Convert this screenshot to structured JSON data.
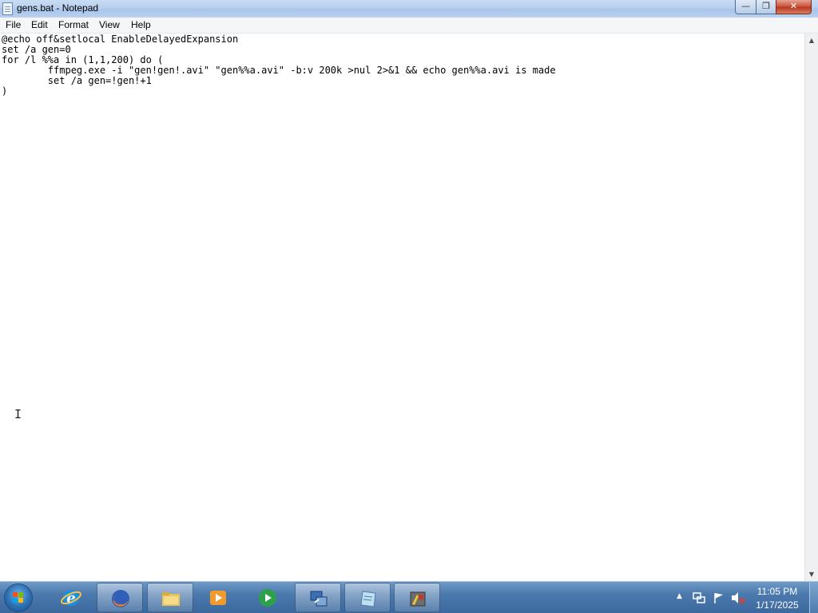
{
  "window": {
    "title": "gens.bat - Notepad",
    "minimize_glyph": "—",
    "maximize_glyph": "❐",
    "close_glyph": "✕"
  },
  "menu": {
    "file": "File",
    "edit": "Edit",
    "format": "Format",
    "view": "View",
    "help": "Help"
  },
  "editor": {
    "content": "@echo off&setlocal EnableDelayedExpansion\nset /a gen=0\nfor /l %%a in (1,1,200) do (\n        ffmpeg.exe -i \"gen!gen!.avi\" \"gen%%a.avi\" -b:v 200k >nul 2>&1 && echo gen%%a.avi is made\n        set /a gen=!gen!+1\n)"
  },
  "scrollbar": {
    "up_arrow": "▲",
    "down_arrow": "▼"
  },
  "taskbar": {
    "items": [
      {
        "icon": "internet-explorer-icon"
      },
      {
        "icon": "firefox-icon"
      },
      {
        "icon": "file-explorer-icon"
      },
      {
        "icon": "media-player-icon"
      },
      {
        "icon": "green-app-icon"
      },
      {
        "icon": "network-app-icon"
      },
      {
        "icon": "notepad-icon"
      },
      {
        "icon": "game-app-icon"
      }
    ]
  },
  "tray": {
    "show_hidden_glyph": "▲",
    "time": "11:05 PM",
    "date": "1/17/2025"
  },
  "colors": {
    "taskbar": "#4b79ad",
    "titlebar": "#b7cfee",
    "close_button": "#c75038"
  }
}
